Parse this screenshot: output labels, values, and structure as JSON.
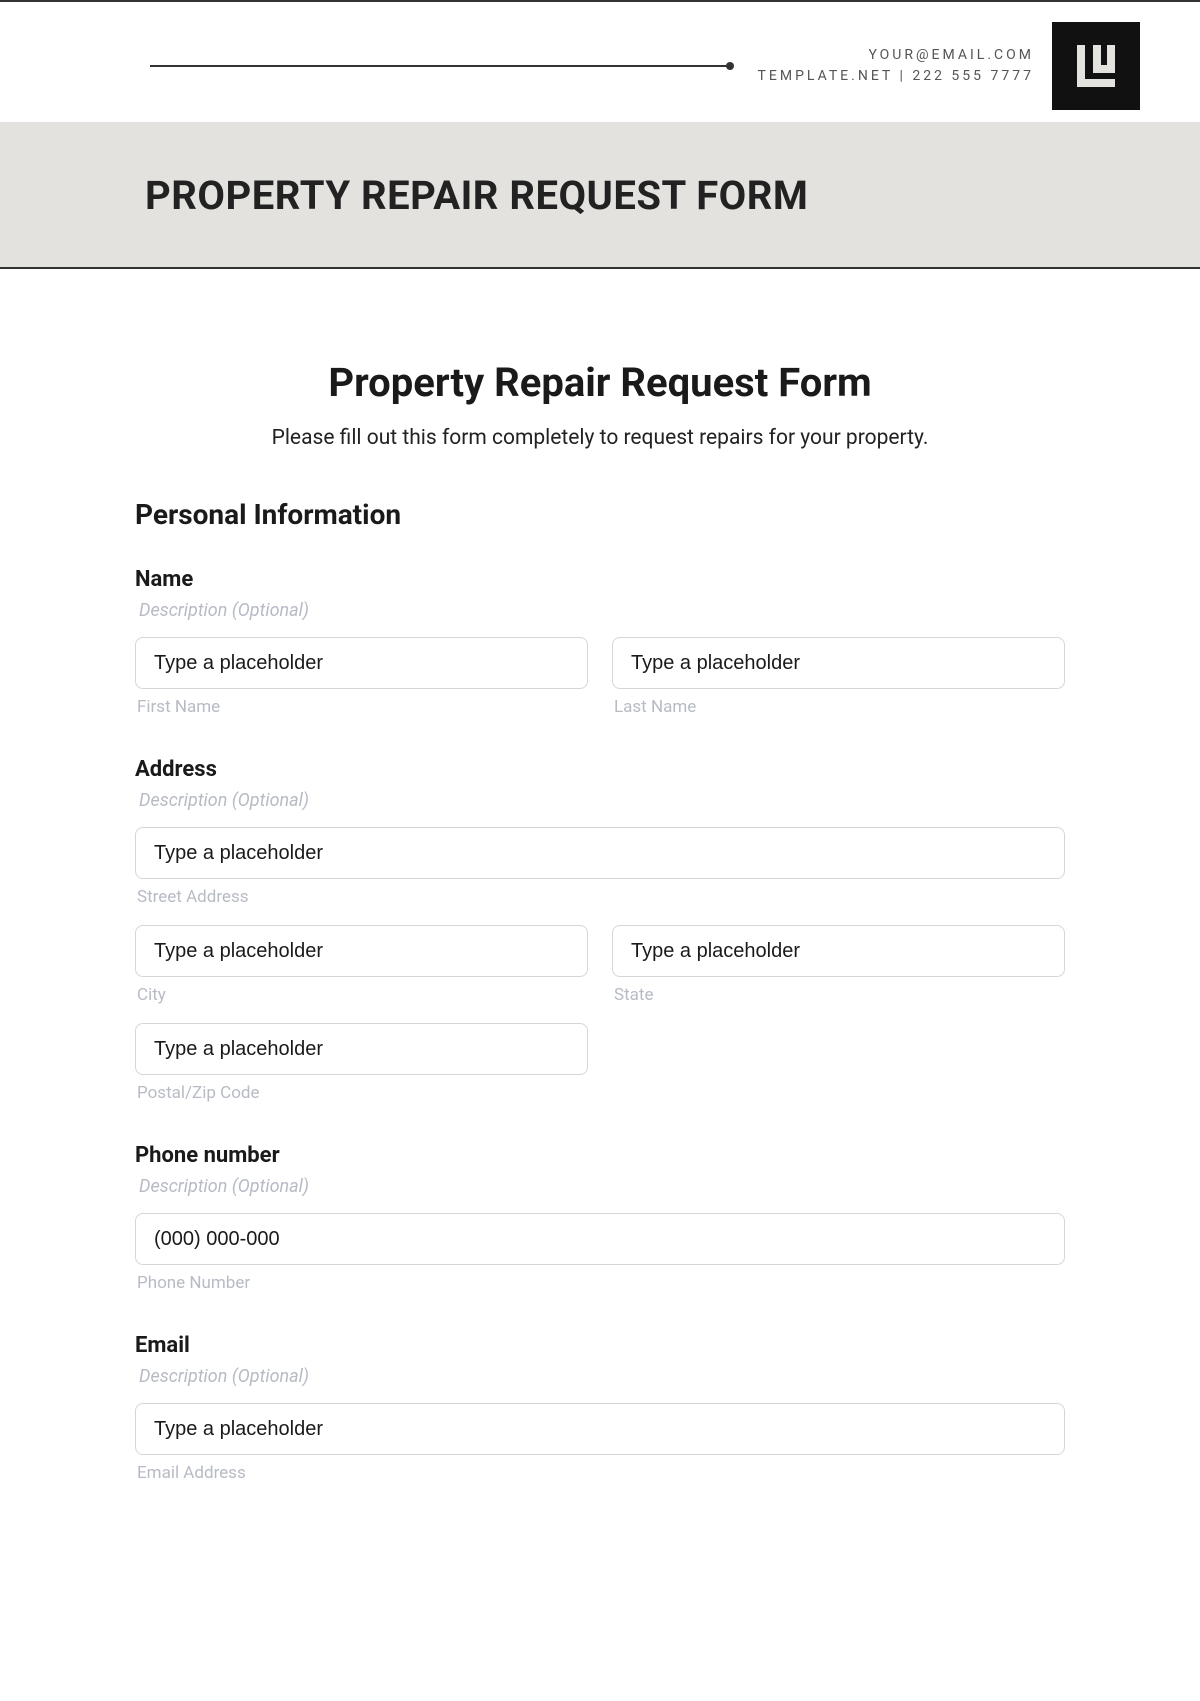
{
  "header": {
    "email": "YOUR@EMAIL.COM",
    "line2": "TEMPLATE.NET | 222 555 7777"
  },
  "banner": {
    "title": "PROPERTY REPAIR REQUEST FORM"
  },
  "form": {
    "title": "Property Repair Request Form",
    "subtitle": "Please fill out this form completely to request repairs for your property.",
    "section_personal": "Personal Information",
    "desc_optional": "Description (Optional)",
    "placeholder_generic": "Type a placeholder",
    "name": {
      "label": "Name",
      "first_sub": "First Name",
      "last_sub": "Last Name"
    },
    "address": {
      "label": "Address",
      "street_sub": "Street Address",
      "city_sub": "City",
      "state_sub": "State",
      "postal_sub": "Postal/Zip Code"
    },
    "phone": {
      "label": "Phone number",
      "placeholder": "(000) 000-000",
      "sub": "Phone Number"
    },
    "email": {
      "label": "Email",
      "sub": "Email Address"
    }
  }
}
